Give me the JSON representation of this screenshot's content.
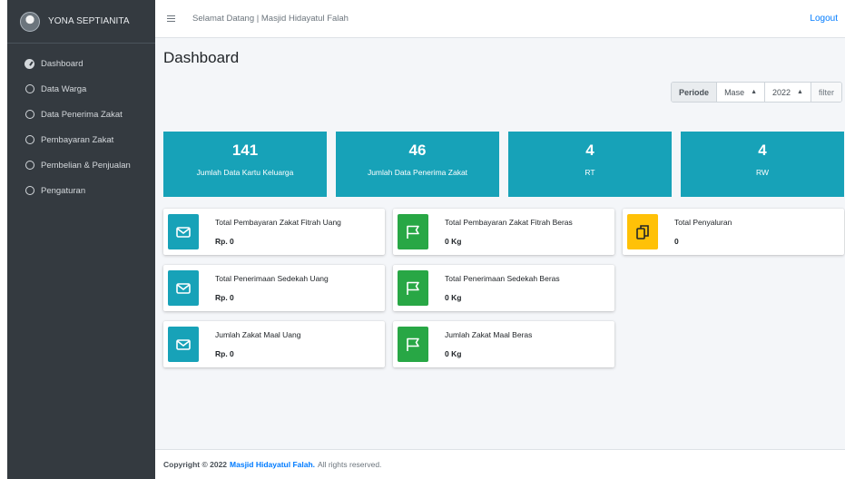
{
  "sidebar": {
    "user_name": "YONA SEPTIANITA",
    "items": [
      {
        "label": "Dashboard",
        "icon": "dashboard-icon"
      },
      {
        "label": "Data Warga",
        "icon": "circle-icon"
      },
      {
        "label": "Data Penerima Zakat",
        "icon": "circle-icon"
      },
      {
        "label": "Pembayaran Zakat",
        "icon": "circle-icon"
      },
      {
        "label": "Pembelian & Penjualan",
        "icon": "circle-icon"
      },
      {
        "label": "Pengaturan",
        "icon": "circle-icon"
      }
    ]
  },
  "topbar": {
    "welcome": "Selamat Datang | Masjid Hidayatul Falah",
    "logout": "Logout"
  },
  "page": {
    "title": "Dashboard"
  },
  "filter": {
    "label": "Periode",
    "month": "Mase",
    "year": "2022",
    "button": "filter"
  },
  "stats": [
    {
      "value": "141",
      "label": "Jumlah Data Kartu Keluarga"
    },
    {
      "value": "46",
      "label": "Jumlah Data Penerima Zakat"
    },
    {
      "value": "4",
      "label": "RT"
    },
    {
      "value": "4",
      "label": "RW"
    }
  ],
  "info_boxes": [
    {
      "text": "Total Pembayaran Zakat Fitrah Uang",
      "value": "Rp. 0",
      "icon": "envelope-icon",
      "color": "#17a2b8"
    },
    {
      "text": "Total Pembayaran Zakat Fitrah Beras",
      "value": "0 Kg",
      "icon": "flag-icon",
      "color": "#28a745"
    },
    {
      "text": "Total Penyaluran",
      "value": "0",
      "icon": "copy-icon",
      "color": "#ffc107"
    },
    {
      "text": "Total Penerimaan Sedekah Uang",
      "value": "Rp. 0",
      "icon": "envelope-icon",
      "color": "#17a2b8"
    },
    {
      "text": "Total Penerimaan Sedekah Beras",
      "value": "0 Kg",
      "icon": "flag-icon",
      "color": "#28a745"
    },
    {
      "text": "Jumlah Zakat Maal Uang",
      "value": "Rp. 0",
      "icon": "envelope-icon",
      "color": "#17a2b8"
    },
    {
      "text": "Jumlah Zakat Maal Beras",
      "value": "0 Kg",
      "icon": "flag-icon",
      "color": "#28a745"
    }
  ],
  "footer": {
    "copyright": "Copyright © 2022",
    "brand": "Masjid Hidayatul Falah.",
    "rights": "All rights reserved."
  },
  "colors": {
    "sidebar_bg": "#343a40",
    "info": "#17a2b8",
    "success": "#28a745",
    "warning": "#ffc107",
    "link": "#007bff"
  }
}
